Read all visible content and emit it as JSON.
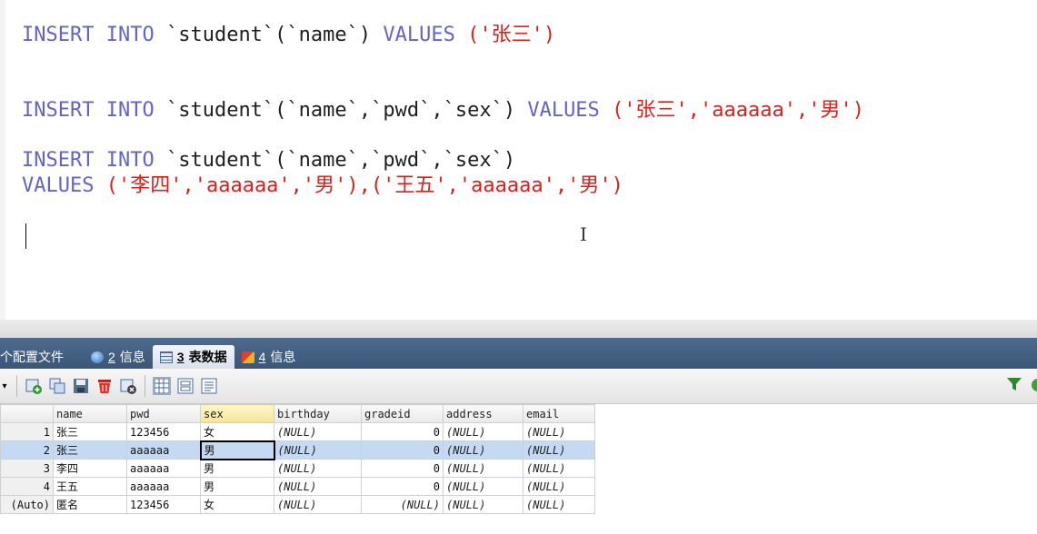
{
  "editor": {
    "line1": {
      "kw1": "INSERT",
      "kw2": "INTO",
      "table": "`student`(`name`)",
      "kw3": "VALUES",
      "values": "('张三')"
    },
    "line2": {
      "kw1": "INSERT",
      "kw2": "INTO",
      "table": "`student`(`name`,`pwd`,`sex`)",
      "kw3": "VALUES",
      "values": "('张三','aaaaaa','男')"
    },
    "line3": {
      "kw1": "INSERT",
      "kw2": "INTO",
      "table": "`student`(`name`,`pwd`,`sex`)"
    },
    "line4": {
      "kw3": "VALUES",
      "values": "('李四','aaaaaa','男'),('王五','aaaaaa','男')"
    }
  },
  "tabs": [
    {
      "prefix": "",
      "label": "个配置文件",
      "icon": "file-icon"
    },
    {
      "prefix": "2",
      "label": "信息",
      "icon": "info-icon"
    },
    {
      "prefix": "3",
      "label": "表数据",
      "icon": "table-icon"
    },
    {
      "prefix": "4",
      "label": "信息",
      "icon": "multi-info-icon"
    }
  ],
  "active_tab": 2,
  "toolbar": {
    "icons": [
      "dropdown-arrow-icon",
      "add-row-icon",
      "duplicate-row-icon",
      "save-icon",
      "delete-icon",
      "refresh-icon",
      "grid-view-icon",
      "form-view-icon",
      "text-view-icon",
      "filter-icon"
    ]
  },
  "grid": {
    "columns": [
      "name",
      "pwd",
      "sex",
      "birthday",
      "gradeid",
      "address",
      "email"
    ],
    "sorted_column": "sex",
    "rows": [
      {
        "rn": "1",
        "cells": [
          "张三",
          "123456",
          "女",
          "(NULL)",
          "0",
          "(NULL)",
          "(NULL)"
        ]
      },
      {
        "rn": "2",
        "cells": [
          "张三",
          "aaaaaa",
          "男",
          "(NULL)",
          "0",
          "(NULL)",
          "(NULL)"
        ]
      },
      {
        "rn": "3",
        "cells": [
          "李四",
          "aaaaaa",
          "男",
          "(NULL)",
          "0",
          "(NULL)",
          "(NULL)"
        ]
      },
      {
        "rn": "4",
        "cells": [
          "王五",
          "aaaaaa",
          "男",
          "(NULL)",
          "0",
          "(NULL)",
          "(NULL)"
        ]
      },
      {
        "rn": "(Auto)",
        "cells": [
          "匿名",
          "123456",
          "女",
          "(NULL)",
          "(NULL)",
          "(NULL)",
          "(NULL)"
        ]
      }
    ],
    "selected_row": 1
  },
  "colors": {
    "keyword": "#6464c8",
    "string": "#d8201c",
    "tab_bar": "#3b5677",
    "selection": "#c6d9f3"
  }
}
